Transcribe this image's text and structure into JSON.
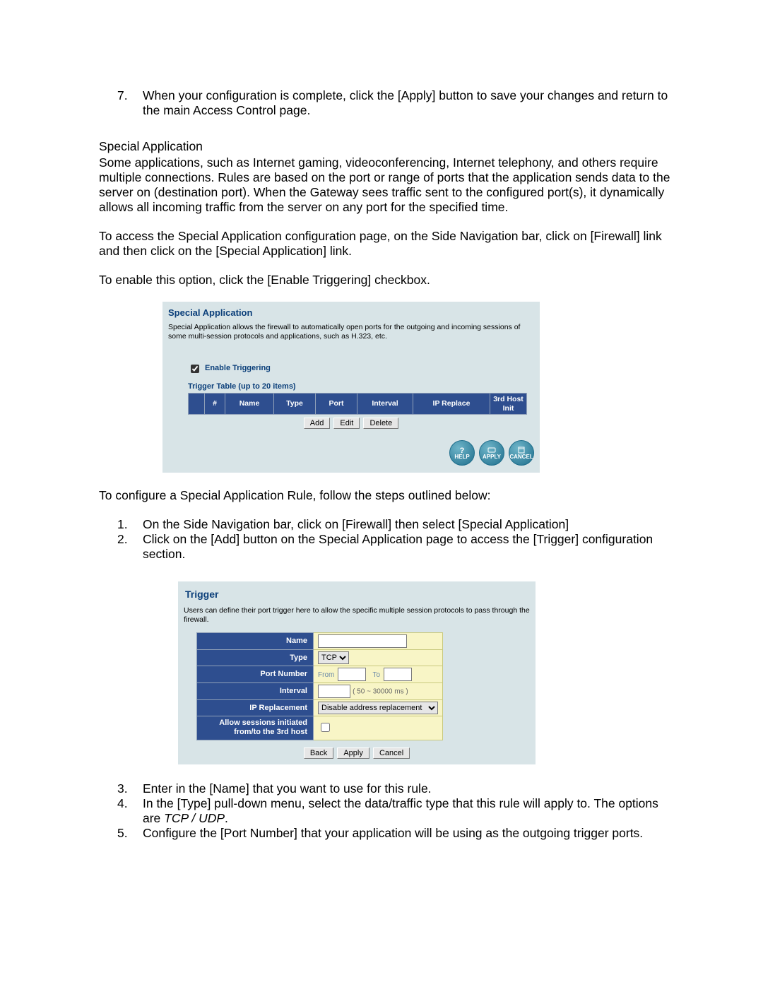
{
  "top_list": {
    "num": "7.",
    "text": "When your configuration is complete, click the [Apply] button to save your changes and return to the main Access Control page."
  },
  "section_title": "Special Application",
  "para1": "Some applications, such as Internet gaming, videoconferencing, Internet telephony, and others require multiple connections.  Rules are based on the port or range of ports that the application sends data to the server on (destination port).  When the Gateway sees traffic sent to the configured port(s), it dynamically allows all incoming traffic from the server on any port for the specified time.",
  "para2": "To access the Special Application configuration page, on the Side Navigation bar, click on [Firewall] link and then click on the [Special Application] link.",
  "para3": "To enable this option, click the [Enable Triggering] checkbox.",
  "panel1": {
    "title": "Special Application",
    "desc": "Special Application allows the firewall to automatically open ports for the outgoing and incoming sessions of some multi-session protocols and applications, such as H.323, etc.",
    "enable_label": "Enable Triggering",
    "table_caption": "Trigger Table (up to 20 items)",
    "headers": [
      "#",
      "Name",
      "Type",
      "Port",
      "Interval",
      "IP Replace",
      "3rd Host Init"
    ],
    "buttons": {
      "add": "Add",
      "edit": "Edit",
      "delete": "Delete"
    },
    "round": {
      "help": "HELP",
      "apply": "APPLY",
      "cancel": "CANCEL"
    }
  },
  "para4": "To configure a Special Application Rule, follow the steps outlined below:",
  "mid_list": [
    {
      "num": "1.",
      "text": "On the Side Navigation bar, click on [Firewall] then select [Special Application]"
    },
    {
      "num": "2.",
      "text": "Click on the [Add] button on the Special Application page to access the [Trigger] configuration section."
    }
  ],
  "panel2": {
    "title": "Trigger",
    "desc": "Users can define their port trigger here to allow the specific multiple session protocols to pass through the firewall.",
    "labels": {
      "name": "Name",
      "type": "Type",
      "port": "Port Number",
      "interval": "Interval",
      "iprep": "IP Replacement",
      "allow_l1": "Allow sessions initiated",
      "allow_l2": "from/to the 3rd host"
    },
    "type_value": "TCP",
    "port_from": "From",
    "port_to": "To",
    "interval_hint": "( 50 ~ 30000 ms )",
    "iprep_value": "Disable address replacement",
    "buttons": {
      "back": "Back",
      "apply": "Apply",
      "cancel": "Cancel"
    }
  },
  "bot_list": [
    {
      "num": "3.",
      "text": "Enter in the [Name] that you want to use for this rule."
    },
    {
      "num": "4.",
      "text_a": "In the [Type] pull-down menu, select the data/traffic type that this rule will apply to.  The options are ",
      "italic": "TCP / UDP",
      "text_b": "."
    },
    {
      "num": "5.",
      "text": "Configure the [Port Number] that your application will be using as the outgoing trigger ports."
    }
  ]
}
